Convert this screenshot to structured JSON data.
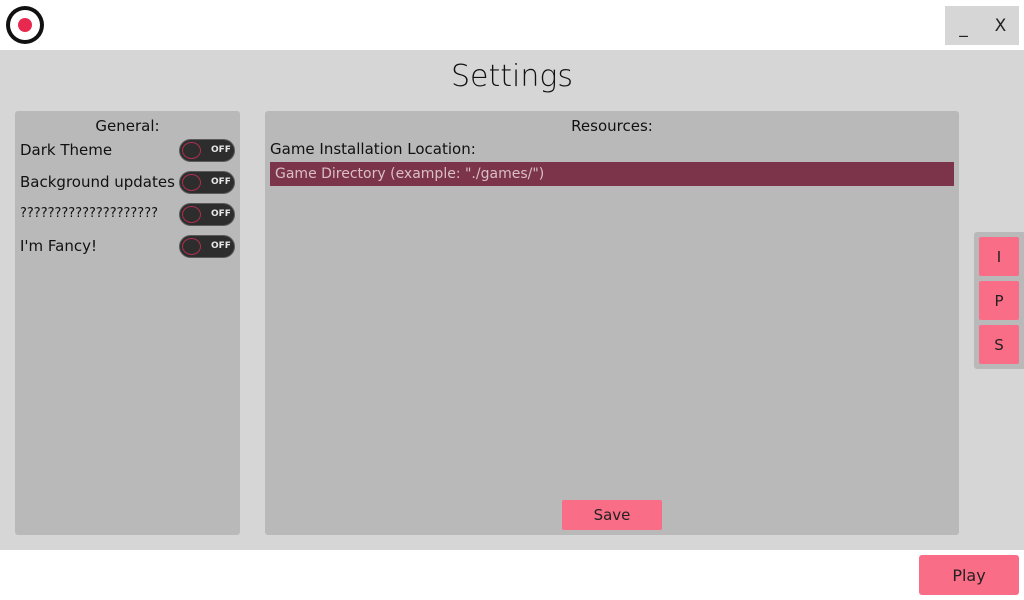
{
  "window": {
    "logo_icon": "target-logo-icon",
    "minimize_label": "_",
    "close_label": "X"
  },
  "page": {
    "title": "Settings"
  },
  "general": {
    "header": "General:",
    "settings": [
      {
        "label": "Dark Theme",
        "state": "OFF"
      },
      {
        "label": "Background updates",
        "state": "OFF"
      },
      {
        "label": "????????????????????",
        "state": "OFF"
      },
      {
        "label": "I'm Fancy!",
        "state": "OFF"
      }
    ]
  },
  "resources": {
    "header": "Resources:",
    "install_label": "Game Installation Location:",
    "directory_value": "",
    "directory_placeholder": "Game Directory (example: \"./games/\")",
    "save_label": "Save"
  },
  "sidenav": {
    "items": [
      {
        "label": "I"
      },
      {
        "label": "P"
      },
      {
        "label": "S"
      }
    ]
  },
  "footer": {
    "play_label": "Play"
  },
  "colors": {
    "accent": "#f96d86",
    "logo_red": "#e8294f",
    "input_bg": "#7b344a",
    "panel_bg": "#b9b9b9",
    "content_bg": "#d6d6d6"
  }
}
